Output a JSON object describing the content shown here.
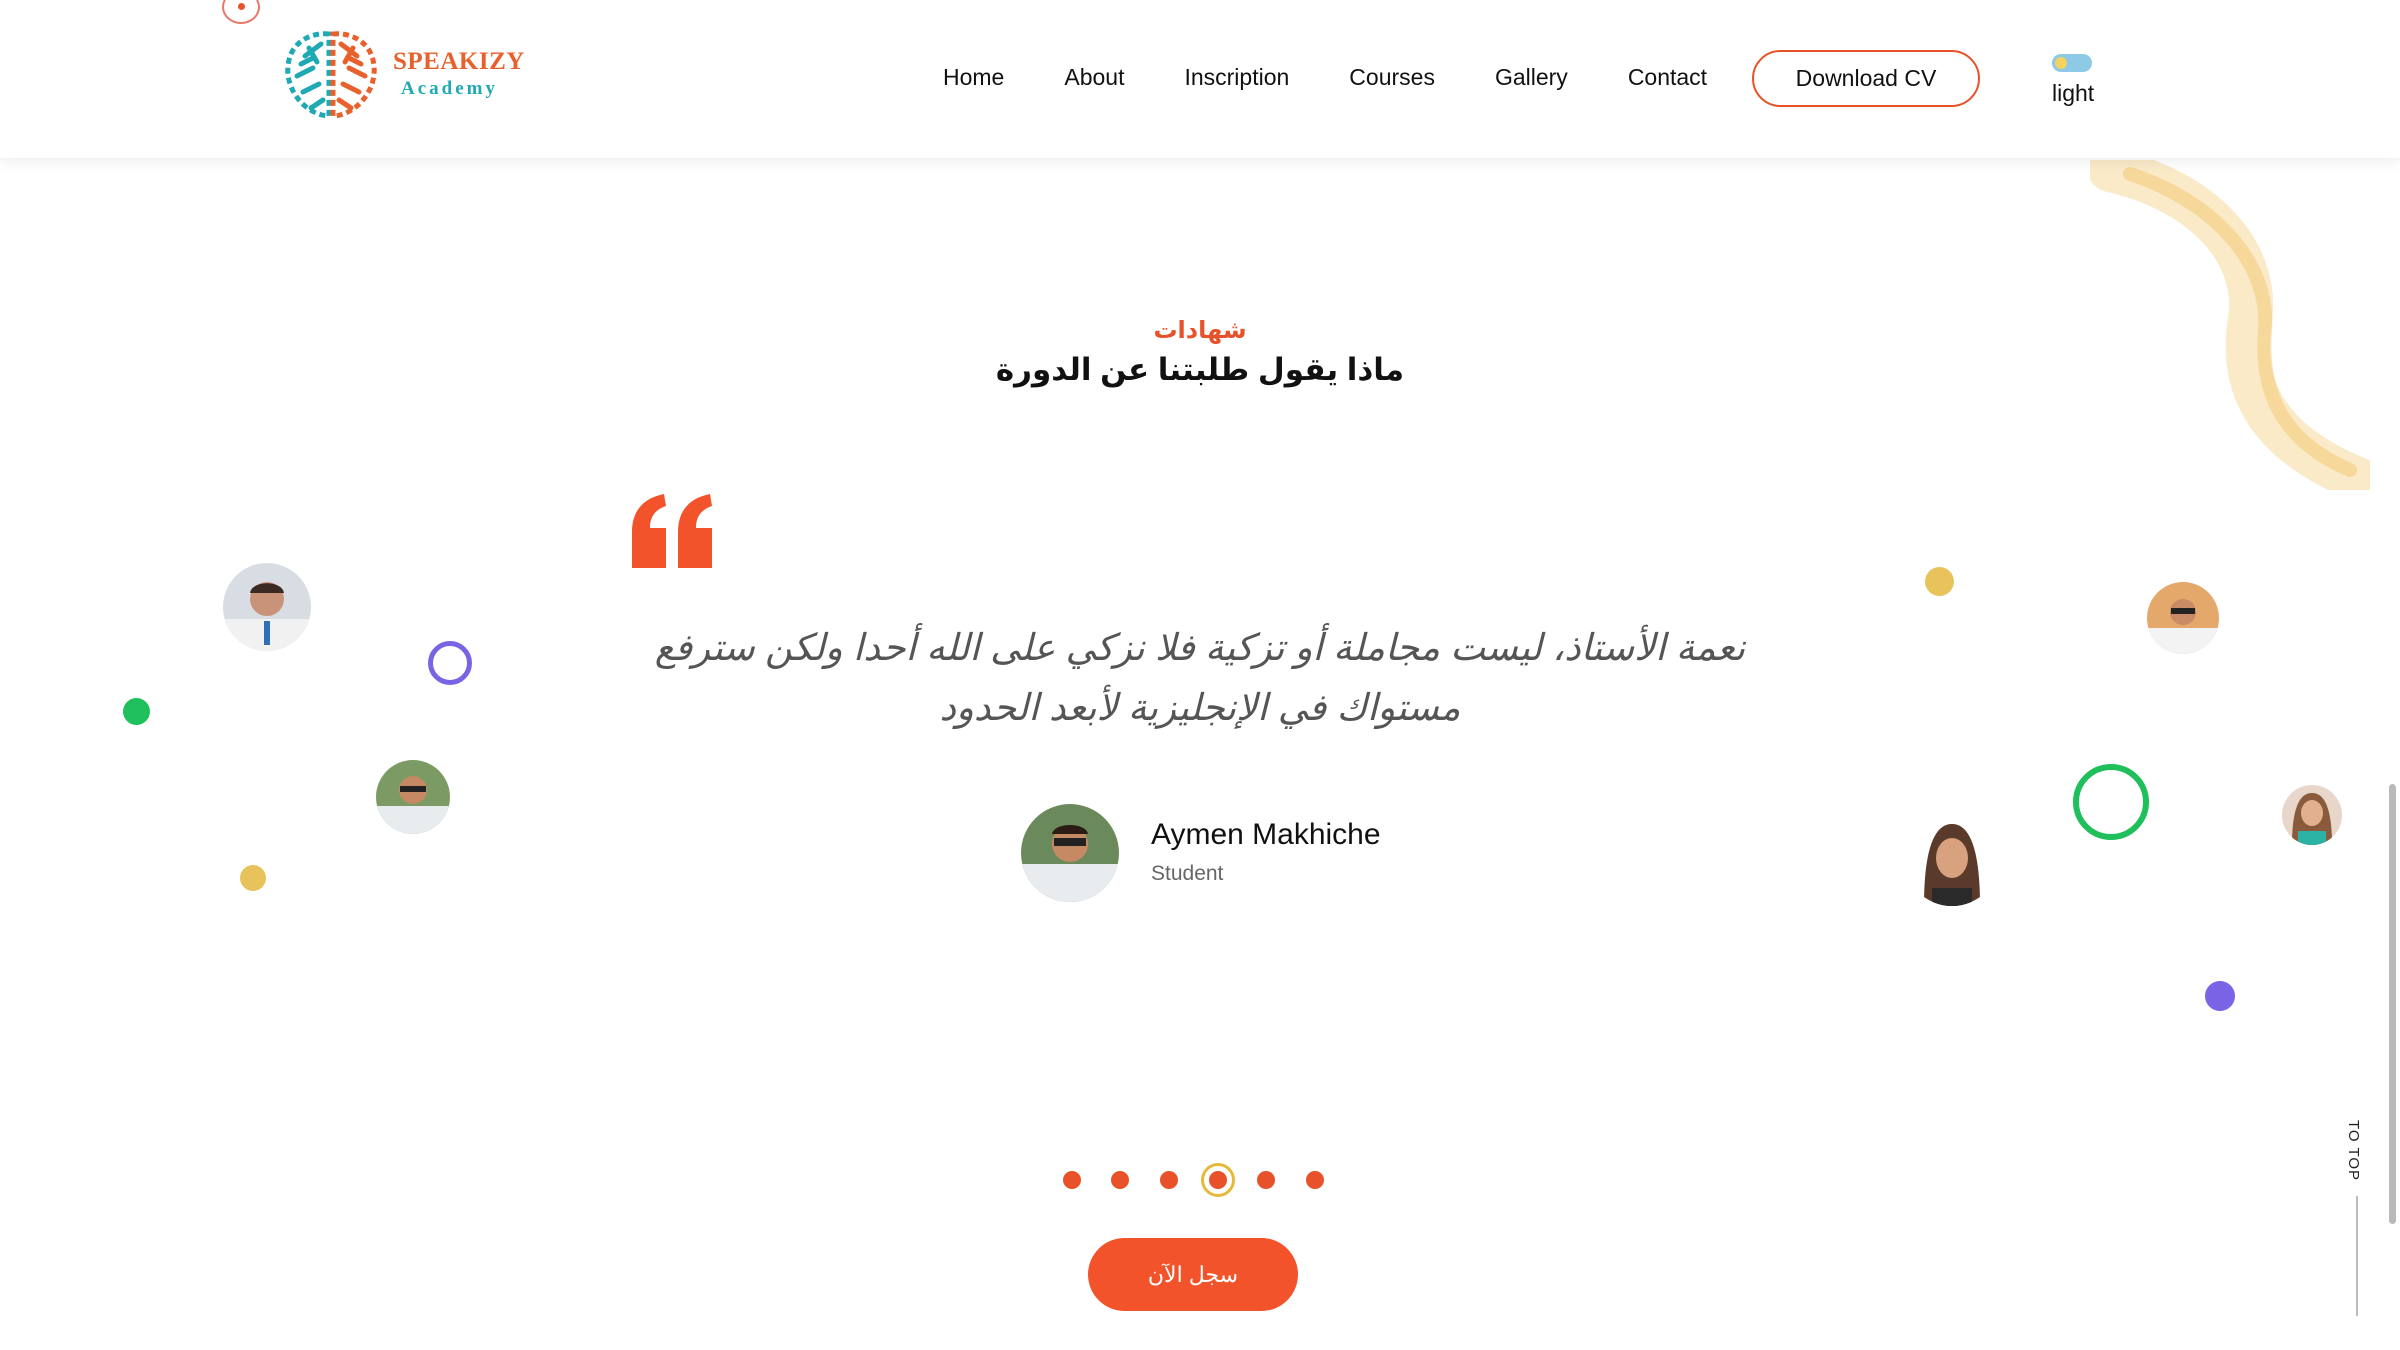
{
  "brand": {
    "name": "SPEAKIZY",
    "subtitle": "Academy"
  },
  "nav": {
    "items": [
      "Home",
      "About",
      "Inscription",
      "Courses",
      "Gallery",
      "Contact"
    ],
    "cta_label": "Download CV",
    "theme_label": "light"
  },
  "section": {
    "tag": "شهادات",
    "title": "ماذا يقول طلبتنا عن الدورة"
  },
  "testimonial": {
    "quote": "نعمة الأستاذ، ليست مجاملة أو تزكية فلا نزكي على الله أحدا ولكن سترفع مستواك في الإنجليزية لأبعد الحدود",
    "author_name": "Aymen Makhiche",
    "author_role": "Student"
  },
  "pagination": {
    "count": 6,
    "active_index": 3
  },
  "register_label": "سجل الآن",
  "to_top_label": "TO TOP",
  "colors": {
    "accent": "#f2532a",
    "teal": "#1fa9b3",
    "yellow": "#e8c25a",
    "green": "#1fbf5c",
    "purple": "#7b63e6"
  }
}
